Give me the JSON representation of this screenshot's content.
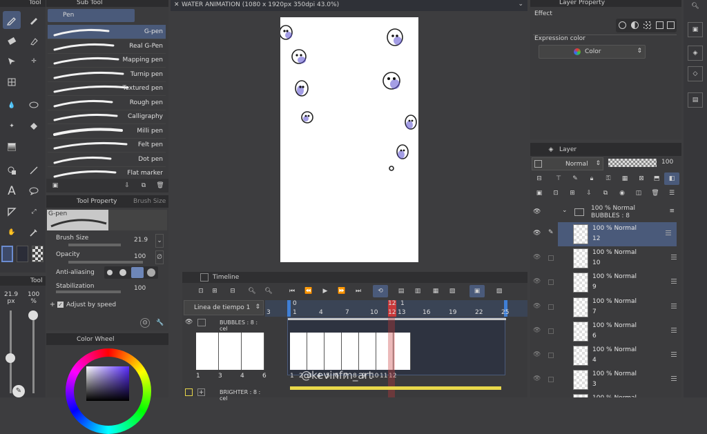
{
  "tool_panel": {
    "title": "Tool"
  },
  "subtool_panel": {
    "title": "Sub Tool",
    "group": "Pen",
    "brushes": [
      "G-pen",
      "Real G-Pen",
      "Mapping pen",
      "Turnip pen",
      "Textured pen",
      "Rough pen",
      "Calligraphy",
      "Milli pen",
      "Felt pen",
      "Dot pen",
      "Flat marker"
    ]
  },
  "tool_property": {
    "title": "Tool Property",
    "tab2": "Brush Size",
    "preview_label": "G-pen",
    "brush_size_label": "Brush Size",
    "brush_size_value": "21.9",
    "opacity_label": "Opacity",
    "opacity_value": "100",
    "antialiasing_label": "Anti-aliasing",
    "stabilization_label": "Stabilization",
    "stabilization_value": "100",
    "adjust_label": "Adjust by speed"
  },
  "size_panel": {
    "title": "Tool",
    "size_value": "21.9\npx",
    "opacity_value": "100\n%"
  },
  "color_wheel": {
    "title": "Color Wheel"
  },
  "canvas": {
    "tab_title": "WATER ANIMATION (1080 x 1920px 350dpi 43.0%)"
  },
  "layer_property": {
    "title": "Layer Property",
    "effect_label": "Effect",
    "expression_label": "Expression color",
    "expression_value": "Color"
  },
  "layer_panel": {
    "title": "Layer",
    "blend_mode": "Normal",
    "opacity": "100",
    "folder": {
      "line1": "100 %  Normal",
      "line2": "BUBBLES : 8"
    },
    "layers": [
      {
        "line1": "100 %  Normal",
        "name": "12",
        "selected": true
      },
      {
        "line1": "100 %  Normal",
        "name": "10",
        "selected": false
      },
      {
        "line1": "100 %  Normal",
        "name": "9",
        "selected": false
      },
      {
        "line1": "100 %  Normal",
        "name": "7",
        "selected": false
      },
      {
        "line1": "100 %  Normal",
        "name": "6",
        "selected": false
      },
      {
        "line1": "100 %  Normal",
        "name": "4",
        "selected": false
      },
      {
        "line1": "100 %  Normal",
        "name": "3",
        "selected": false
      },
      {
        "line1": "100 %  Normal",
        "name": "",
        "selected": false
      }
    ]
  },
  "timeline": {
    "title": "Timeline",
    "timeline_name": "Linea de tiempo 1",
    "ruler_marks": [
      "3",
      "1",
      "4",
      "7",
      "10",
      "12",
      "13",
      "16",
      "19",
      "22",
      "25"
    ],
    "ruler_top": [
      "0",
      "12",
      "1"
    ],
    "track1_name": "BUBBLES : 8 : cel",
    "track2_name": "BRIGHTER : 8 : cel",
    "left_frame_labels": [
      "1",
      "3",
      "4",
      "6"
    ],
    "right_frame_labels": [
      "1",
      "2",
      "3",
      "4",
      "5",
      "6",
      "7",
      "8",
      "9",
      "10",
      "11",
      "12"
    ],
    "watermark": "@kevinfm_art"
  },
  "colors": {
    "accent": "#4f7fd0",
    "red_marker": "#c8383a",
    "yellow": "#e9d84a",
    "selection": "#4a5a7a"
  }
}
